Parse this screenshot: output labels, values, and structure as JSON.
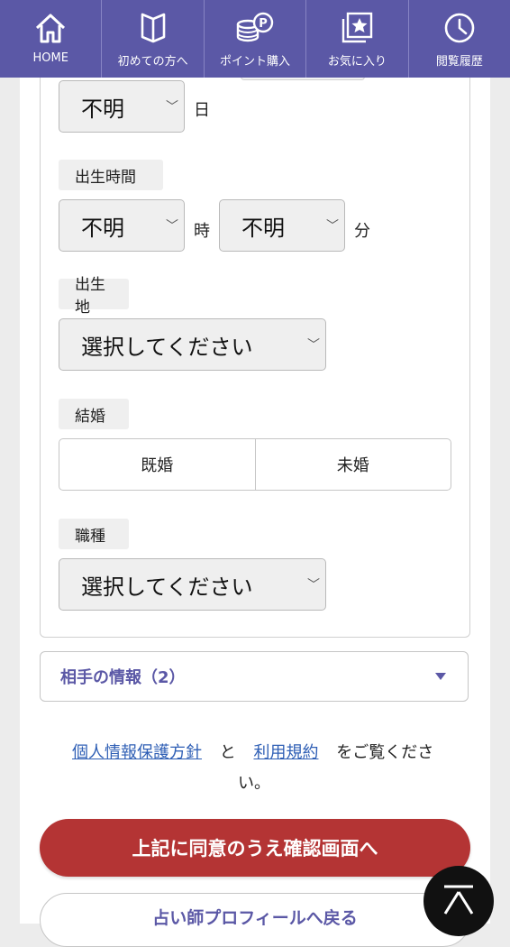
{
  "nav": {
    "items": [
      {
        "label": "HOME",
        "icon": "home-icon"
      },
      {
        "label": "初めての方へ",
        "icon": "book-icon"
      },
      {
        "label": "ポイント購入",
        "icon": "coins-icon"
      },
      {
        "label": "お気に入り",
        "icon": "star-icon"
      },
      {
        "label": "閲覧履歴",
        "icon": "clock-icon"
      }
    ],
    "colors": {
      "bg": "#5b58a6"
    }
  },
  "form": {
    "birth_day": {
      "value": "不明",
      "unit": "日"
    },
    "birth_time": {
      "label": "出生時間",
      "hour": {
        "value": "不明",
        "unit": "時"
      },
      "minute": {
        "value": "不明",
        "unit": "分"
      }
    },
    "birthplace": {
      "label": "出生地",
      "value": "選択してください"
    },
    "marriage": {
      "label": "結婚",
      "options": [
        "既婚",
        "未婚"
      ]
    },
    "occupation": {
      "label": "職種",
      "value": "選択してください"
    }
  },
  "partner_section": {
    "title": "相手の情報（2）"
  },
  "consent": {
    "privacy_link": "個人情報保護方針",
    "and": "と",
    "terms_link": "利用規約",
    "suffix": "をご覧くださ",
    "suffix2": "い。"
  },
  "buttons": {
    "confirm": "上記に同意のうえ確認画面へ",
    "back": "占い師プロフィールへ戻る",
    "confirm_color": "#b43434"
  }
}
